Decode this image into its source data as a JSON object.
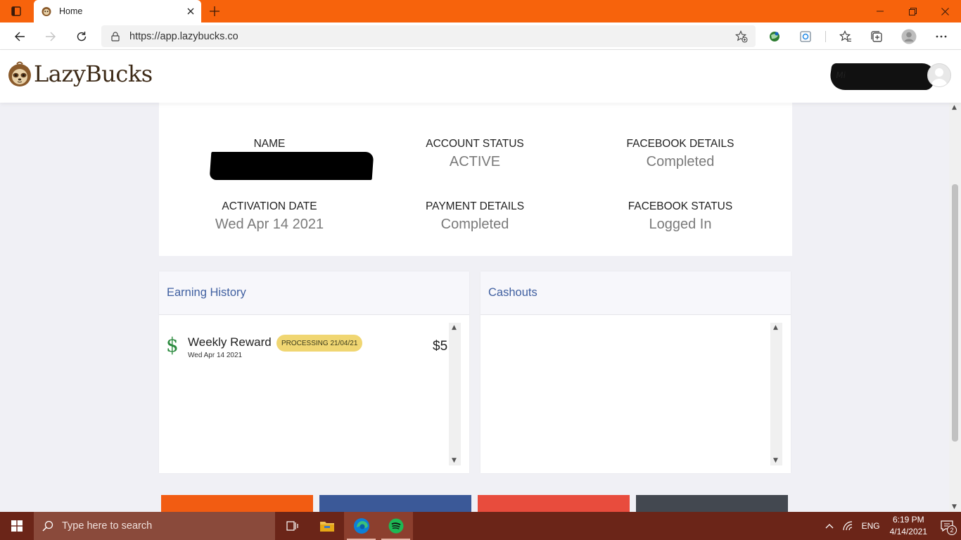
{
  "browser": {
    "tab_title": "Home",
    "url": "https://app.lazybucks.co"
  },
  "site": {
    "logo_text": "LazyBucks",
    "user_name": "Mi"
  },
  "account": {
    "name_label": "NAME",
    "status_label": "ACCOUNT STATUS",
    "status_value": "ACTIVE",
    "fb_details_label": "FACEBOOK DETAILS",
    "fb_details_value": "Completed",
    "activation_label": "ACTIVATION DATE",
    "activation_value": "Wed Apr 14 2021",
    "payment_label": "PAYMENT DETAILS",
    "payment_value": "Completed",
    "fb_status_label": "FACEBOOK STATUS",
    "fb_status_value": "Logged In"
  },
  "earning_history": {
    "title": "Earning History",
    "items": [
      {
        "icon": "dollar-icon",
        "symbol": "$",
        "title": "Weekly Reward",
        "date": "Wed Apr 14 2021",
        "badge": "PROCESSING 21/04/21",
        "amount": "$5"
      }
    ]
  },
  "cashouts": {
    "title": "Cashouts"
  },
  "tiles": {
    "colors": [
      "#f25c12",
      "#3b5998",
      "#e84c3d",
      "#434850"
    ]
  },
  "taskbar": {
    "search_placeholder": "Type here to search",
    "language": "ENG",
    "time": "6:19 PM",
    "date": "4/14/2021",
    "notification_count": "2"
  },
  "colors": {
    "browser_accent": "#f7630c",
    "link_blue": "#3f5fa0",
    "badge_yellow": "#f0d672",
    "money_green": "#2b8a3e"
  }
}
